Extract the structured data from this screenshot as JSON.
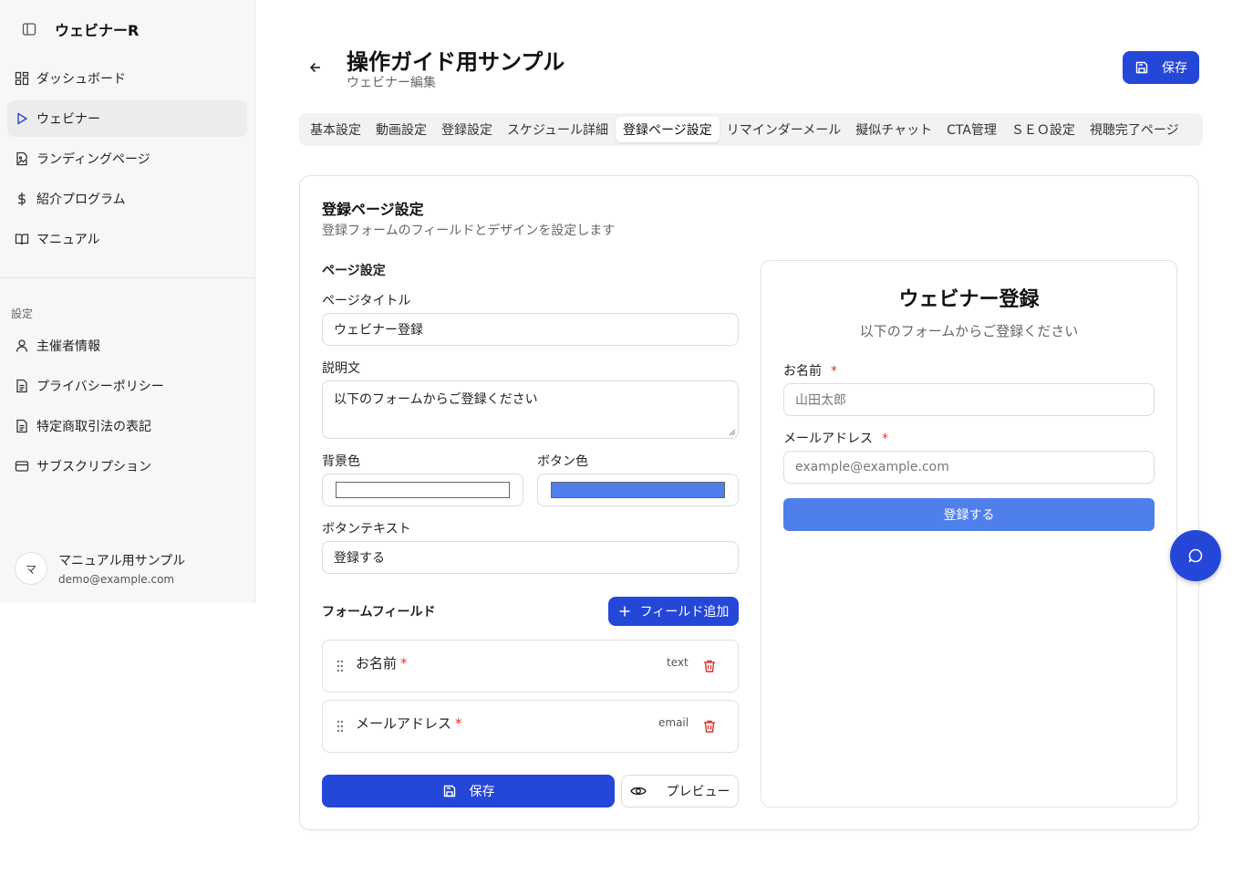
{
  "sidebar": {
    "brand": "ウェビナーR",
    "items": [
      {
        "label": "ダッシュボード",
        "icon": "dashboard-icon"
      },
      {
        "label": "ウェビナー",
        "icon": "play-icon",
        "active": true
      },
      {
        "label": "ランディングページ",
        "icon": "file-image-icon"
      },
      {
        "label": "紹介プログラム",
        "icon": "dollar-icon"
      },
      {
        "label": "マニュアル",
        "icon": "book-icon"
      }
    ],
    "section_label": "設定",
    "settings_items": [
      {
        "label": "主催者情報",
        "icon": "user-icon"
      },
      {
        "label": "プライバシーポリシー",
        "icon": "document-icon"
      },
      {
        "label": "特定商取引法の表記",
        "icon": "document-icon"
      },
      {
        "label": "サブスクリプション",
        "icon": "credit-card-icon"
      }
    ],
    "user": {
      "avatar": "マ",
      "name": "マニュアル用サンプル",
      "email": "demo@example.com"
    }
  },
  "header": {
    "title": "操作ガイド用サンプル",
    "subtitle": "ウェビナー編集",
    "save_label": "保存"
  },
  "tabs": [
    "基本設定",
    "動画設定",
    "登録設定",
    "スケジュール詳細",
    "登録ページ設定",
    "リマインダーメール",
    "擬似チャット",
    "CTA管理",
    "ＳＥＯ設定",
    "視聴完了ページ"
  ],
  "active_tab": "登録ページ設定",
  "card": {
    "title": "登録ページ設定",
    "description": "登録フォームのフィールドとデザインを設定します",
    "page_settings_label": "ページ設定",
    "page_title_label": "ページタイトル",
    "page_title_value": "ウェビナー登録",
    "description_label": "説明文",
    "description_value": "以下のフォームからご登録ください",
    "bg_color_label": "背景色",
    "bg_color_value": "#ffffff",
    "button_color_label": "ボタン色",
    "button_color_value": "#4f7fea",
    "button_text_label": "ボタンテキスト",
    "button_text_value": "登録する",
    "form_fields_label": "フォームフィールド",
    "add_field_label": "フィールド追加",
    "fields": [
      {
        "name": "お名前",
        "required_mark": "*",
        "type": "text"
      },
      {
        "name": "メールアドレス",
        "required_mark": "*",
        "type": "email"
      }
    ],
    "save_label": "保存",
    "preview_label": "プレビュー"
  },
  "preview": {
    "title": "ウェビナー登録",
    "description": "以下のフォームからご登録ください",
    "name_label": "お名前",
    "name_placeholder": "山田太郎",
    "email_label": "メールアドレス",
    "email_placeholder": "example@example.com",
    "required_mark": "*",
    "submit_label": "登録する"
  },
  "colors": {
    "accent": "#2547d8",
    "required": "#d9342b",
    "preview_button": "#4f7fea"
  }
}
